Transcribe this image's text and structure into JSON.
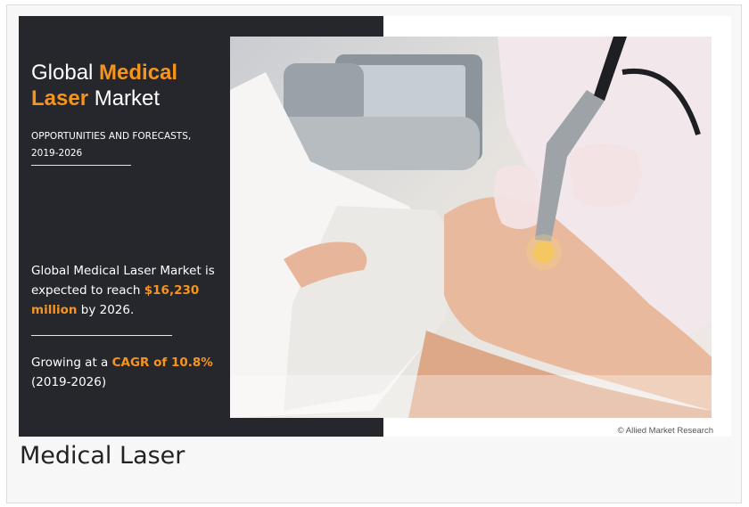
{
  "infographic": {
    "title_prefix": "Global ",
    "title_accent": "Medical",
    "title_line2_accent": "Laser",
    "title_suffix": " Market",
    "subtitle_line1": "OPPORTUNITIES AND FORECASTS,",
    "subtitle_line2": "2019-2026",
    "stat1_pre": "Global Medical Laser Market is expected to reach ",
    "stat1_accent": "$16,230 million",
    "stat1_post": " by 2026.",
    "stat2_pre": "Growing at a ",
    "stat2_accent": "CAGR of 10.8%",
    "stat2_post": "(2019-2026)",
    "credit": "© Allied Market Research",
    "accent_color": "#f7941d",
    "panel_color": "#25272d"
  },
  "caption": "Medical Laser"
}
